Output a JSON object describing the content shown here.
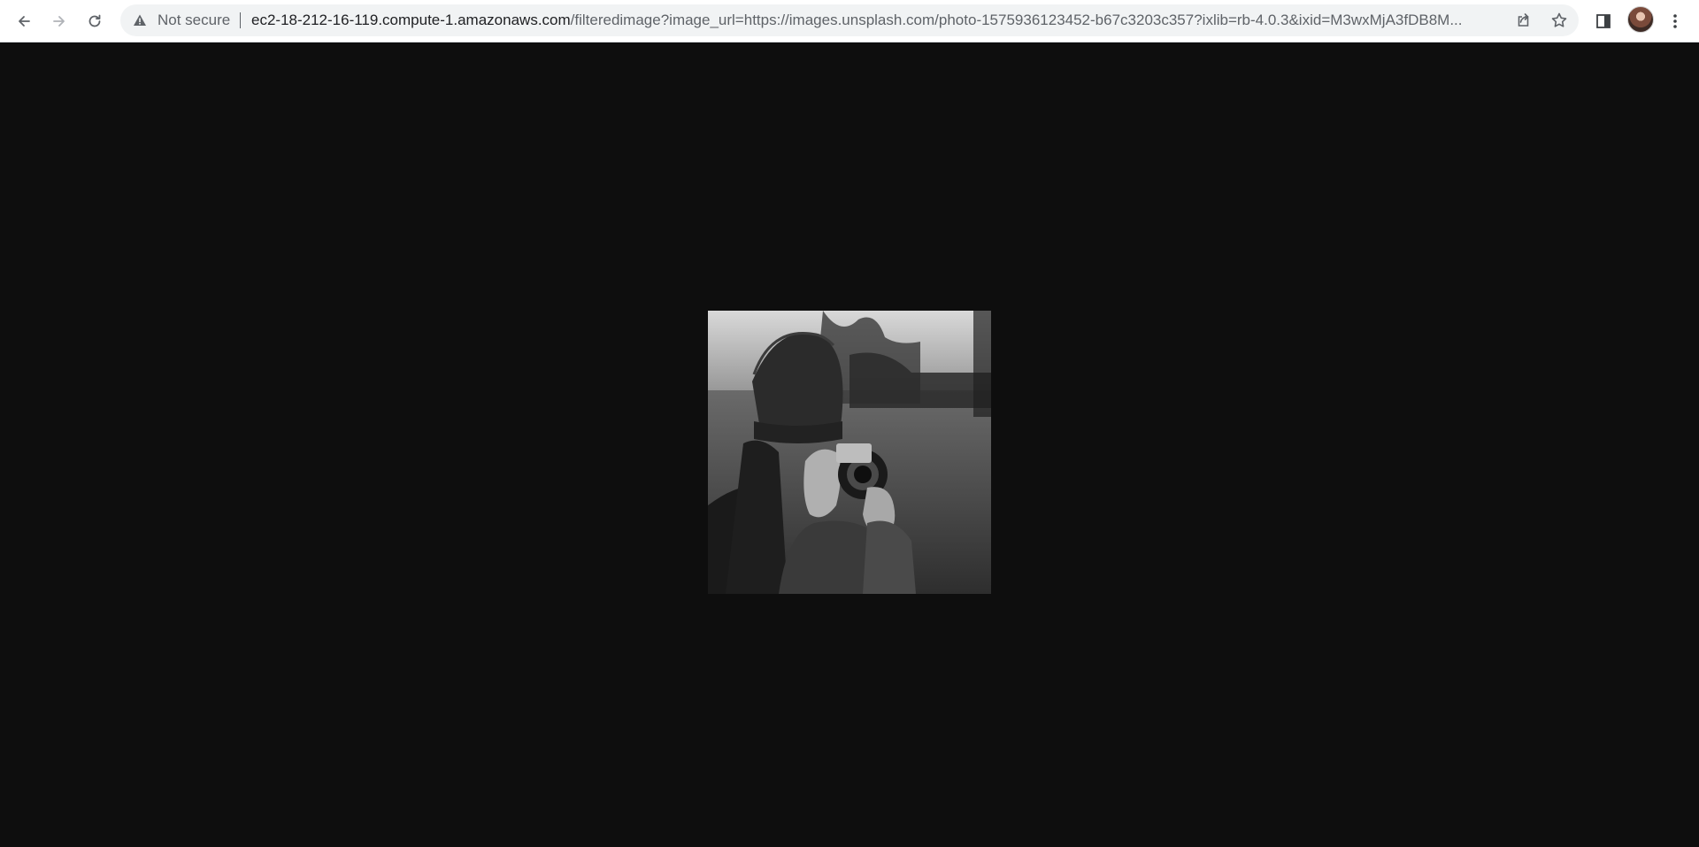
{
  "browser": {
    "security_label": "Not secure",
    "url_host": "ec2-18-212-16-119.compute-1.amazonaws.com",
    "url_path": "/filteredimage?image_url=https://images.unsplash.com/photo-1575936123452-b67c3203c357?ixlib=rb-4.0.3&ixid=M3wxMjA3fDB8M...",
    "icons": {
      "back": "arrow-left-icon",
      "forward": "arrow-right-icon",
      "reload": "reload-icon",
      "warning": "warning-triangle-icon",
      "share": "share-icon",
      "bookmark": "star-icon",
      "side_panel": "side-panel-icon",
      "profile": "avatar",
      "menu": "kebab-menu-icon"
    }
  },
  "page": {
    "background": "#0e0e0e",
    "image": {
      "description_icon": "grayscale-photo",
      "filter": "grayscale"
    }
  }
}
